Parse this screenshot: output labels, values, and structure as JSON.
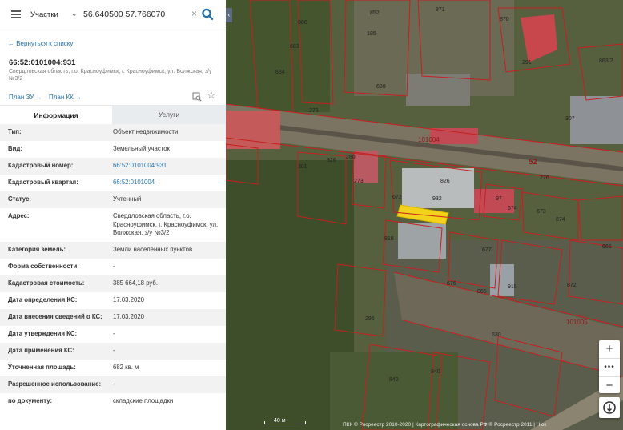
{
  "search": {
    "layer": "Участки",
    "query": "56.640500 57.766070"
  },
  "back_link": "← Вернуться к списку",
  "object": {
    "cadastral_number": "66:52:0101004:931",
    "address_line": "Свердловская область, г.о. Красноуфимск, г. Красноуфимск, ул. Волжская, з/у №3/2"
  },
  "plans": {
    "zu": "План ЗУ →",
    "kk": "План КК →"
  },
  "tabs": {
    "info": "Информация",
    "services": "Услуги"
  },
  "attributes": [
    {
      "label": "Тип:",
      "value": "Объект недвижимости"
    },
    {
      "label": "Вид:",
      "value": "Земельный участок"
    },
    {
      "label": "Кадастровый номер:",
      "value": "66:52:0101004:931"
    },
    {
      "label": "Кадастровый квартал:",
      "value": "66:52:0101004"
    },
    {
      "label": "Статус:",
      "value": "Учтенный"
    },
    {
      "label": "Адрес:",
      "value": "Свердловская область, г.о. Красноуфимск, г. Красноуфимск, ул. Волжская, з/у №3/2"
    },
    {
      "label": "Категория земель:",
      "value": "Земли населённых пунктов"
    },
    {
      "label": "Форма собственности:",
      "value": "-"
    },
    {
      "label": "Кадастровая стоимость:",
      "value": "385 664,18 руб."
    },
    {
      "label": "Дата определения КС:",
      "value": "17.03.2020"
    },
    {
      "label": "Дата внесения сведений о КС:",
      "value": "17.03.2020"
    },
    {
      "label": "Дата утверждения КС:",
      "value": "-"
    },
    {
      "label": "Дата применения КС:",
      "value": "-"
    },
    {
      "label": "Уточненная площадь:",
      "value": "682 кв. м"
    },
    {
      "label": "Разрешенное использование:",
      "value": "-"
    },
    {
      "label": "по документу:",
      "value": "складские площадки"
    }
  ],
  "map": {
    "parcel_labels": [
      "852",
      "871",
      "886",
      "870",
      "683",
      "291",
      "195",
      "684",
      "690",
      "863/2",
      "276",
      "307",
      "52",
      "276",
      "301",
      "926",
      "273",
      "280",
      "826",
      "932",
      "672",
      "97",
      "674",
      "874",
      "818",
      "677",
      "865",
      "915",
      "872",
      "630",
      "673",
      "676",
      "665",
      "296",
      "840",
      "840",
      "101004",
      "101005"
    ],
    "scale_label": "40 м",
    "copyright": "ПКК © Росреестр 2010-2020 | Картографическая основа РФ © Росреестр 2011 | Нюк"
  },
  "colors": {
    "accent": "#1f6fae",
    "parcel_border": "#c81e1e",
    "selected_parcel": "#f2d21b"
  }
}
